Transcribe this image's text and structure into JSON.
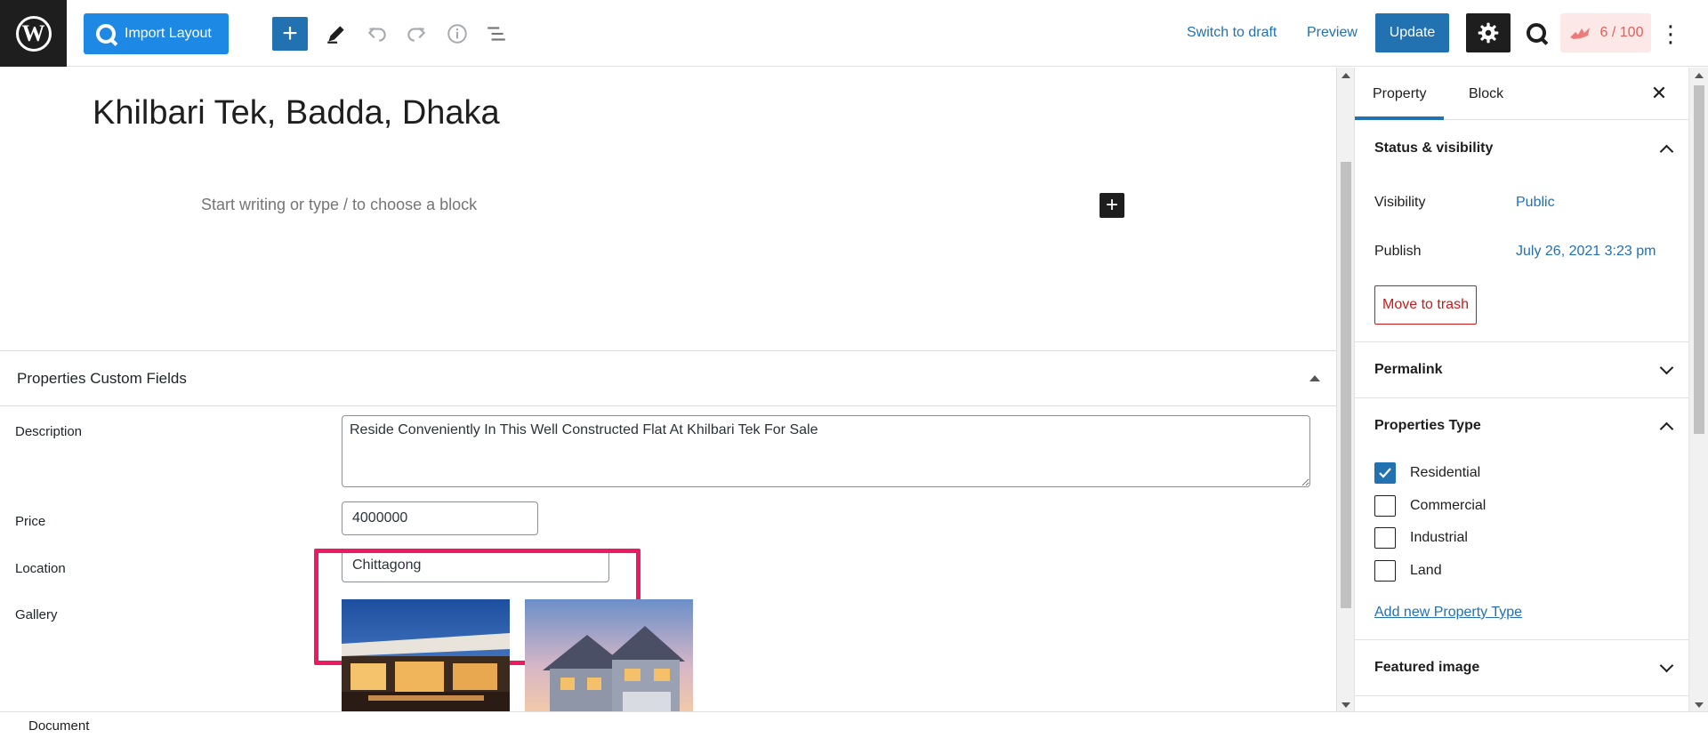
{
  "toolbar": {
    "wp_logo": "W",
    "import_layout_label": "Import Layout",
    "add_block_symbol": "+",
    "switch_to_draft": "Switch to draft",
    "preview": "Preview",
    "update": "Update",
    "score": "6 / 100",
    "more_symbol": "⋮",
    "icons": [
      "wordpress-icon",
      "plus-icon",
      "pencil-icon",
      "undo-icon",
      "redo-icon",
      "info-icon",
      "list-view-icon",
      "gear-icon",
      "quform-icon",
      "flame-icon",
      "more-vertical-icon"
    ]
  },
  "editor": {
    "post_title": "Khilbari Tek, Badda, Dhaka",
    "block_placeholder": "Start writing or type / to choose a block",
    "block_add_symbol": "+"
  },
  "custom_fields": {
    "title": "Properties Custom Fields",
    "description_label": "Description",
    "description_value": "Reside Conveniently In This Well Constructed Flat At Khilbari Tek For Sale",
    "price_label": "Price",
    "price_value": "4000000",
    "location_label": "Location",
    "location_value": "Chittagong",
    "gallery_label": "Gallery"
  },
  "sidebar": {
    "tabs": [
      {
        "label": "Property",
        "active": true
      },
      {
        "label": "Block",
        "active": false
      }
    ],
    "close_symbol": "✕",
    "status_visibility": {
      "title": "Status & visibility",
      "visibility_label": "Visibility",
      "visibility_value": "Public",
      "publish_label": "Publish",
      "publish_value": "July 26, 2021 3:23 pm",
      "trash_label": "Move to trash"
    },
    "permalink_title": "Permalink",
    "properties_type": {
      "title": "Properties Type",
      "options": [
        {
          "label": "Residential",
          "checked": true
        },
        {
          "label": "Commercial",
          "checked": false
        },
        {
          "label": "Industrial",
          "checked": false
        },
        {
          "label": "Land",
          "checked": false
        }
      ],
      "add_new_label": "Add new Property Type"
    },
    "featured_image_title": "Featured image"
  },
  "footer": {
    "breadcrumb": "Document"
  },
  "colors": {
    "accent": "#2271b1",
    "import_button": "#1e88e5",
    "highlight": "#ec1a61",
    "danger": "#cc1818",
    "score_text": "#e35d5d",
    "score_bg": "#fde8e8"
  }
}
